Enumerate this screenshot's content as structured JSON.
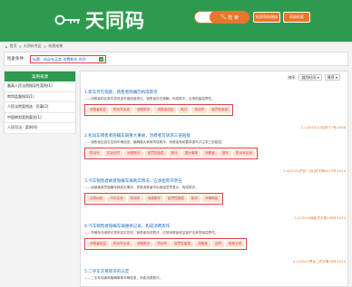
{
  "header": {
    "logo_text": "天同码",
    "search_button": "检 索",
    "btn1": "检索帮助指南",
    "btn2": "高级检索"
  },
  "breadcrumb": [
    "首页",
    "天同码专区",
    "检索结果"
  ],
  "condition": {
    "label": "检索条件:",
    "value": "标题：机动车买卖 消费欺诈 合同"
  },
  "sidebar": {
    "title": "案例来源",
    "items": [
      "最高人民法院指导性案例(1)",
      "审判监督指导(1)",
      "人民法院案例选 · 民事(2)",
      "中国审判案例要览(1)",
      "人民司法 · 案例(6)"
    ]
  },
  "sort": {
    "label": "排序:",
    "value": "裁判时间",
    "order": "降序"
  },
  "results": [
    {
      "title": "1.新车存在瑕疵，销售者隐瞒仍构成欺诈",
      "summary": "——消费者购买新车发现该车曾经维修过，销售者存在隐瞒，构成欺诈，应承担赔偿责任。",
      "tags": [
        "消费者权益",
        "机动车买卖",
        "消费欺诈",
        "消费者权益",
        "欺诈",
        "机动车",
        "惩罚性赔偿"
      ],
      "meta": "1.1(2015)12民终/17号/2008"
    },
    {
      "title": "2.机动车销售者隐瞒车辆重大事故，消费者可请求三倍赔偿",
      "summary": "——销售者应如实告知车辆信息，隐瞒重大事故构成欺诈，消费者有权要求退车并主张三倍赔偿。",
      "tags": [
        "机动车",
        "买卖合同",
        "消费欺诈",
        "惩罚性赔偿",
        "欺诈",
        "重大事故",
        "消费者",
        "退车",
        "机动车买卖"
      ],
      "meta": "2.4(2014)沪民一(民)终字第2012号/2014"
    },
    {
      "title": "3.汽车销售者故意隐瞒车辆真实情况，应承担欺诈责任",
      "summary": "——经营者故意隐瞒车辆真实情况，导致消费者作出错误意思表示，构成欺诈。",
      "tags": [
        "合同纠纷",
        "汽车买卖",
        "机动车",
        "消费欺诈",
        "惩罚性赔偿",
        "欺诈",
        "车辆瑕疵"
      ],
      "meta": "3.1(2013)闽民终字第138号/2013"
    },
    {
      "title": "4.汽车销售者隐瞒车辆维修记录，构成消费欺诈",
      "summary": "——车辆存在维修记录未如实告知，销售者构成欺诈，应按消费者权益保护法承担赔偿责任。",
      "tags": [
        "消费者权益",
        "机动车买卖",
        "消费欺诈",
        "机动车",
        "惩罚性赔偿",
        "消费者",
        "合同",
        "维修记录"
      ],
      "meta": "4.1(2015)青民二终字第28号/2015"
    },
    {
      "title": "5.二手车交易欺诈的认定",
      "summary": "——二手车经销商隐瞒事故车辆信息，构成消费欺诈。",
      "tags": [],
      "meta": ""
    }
  ]
}
